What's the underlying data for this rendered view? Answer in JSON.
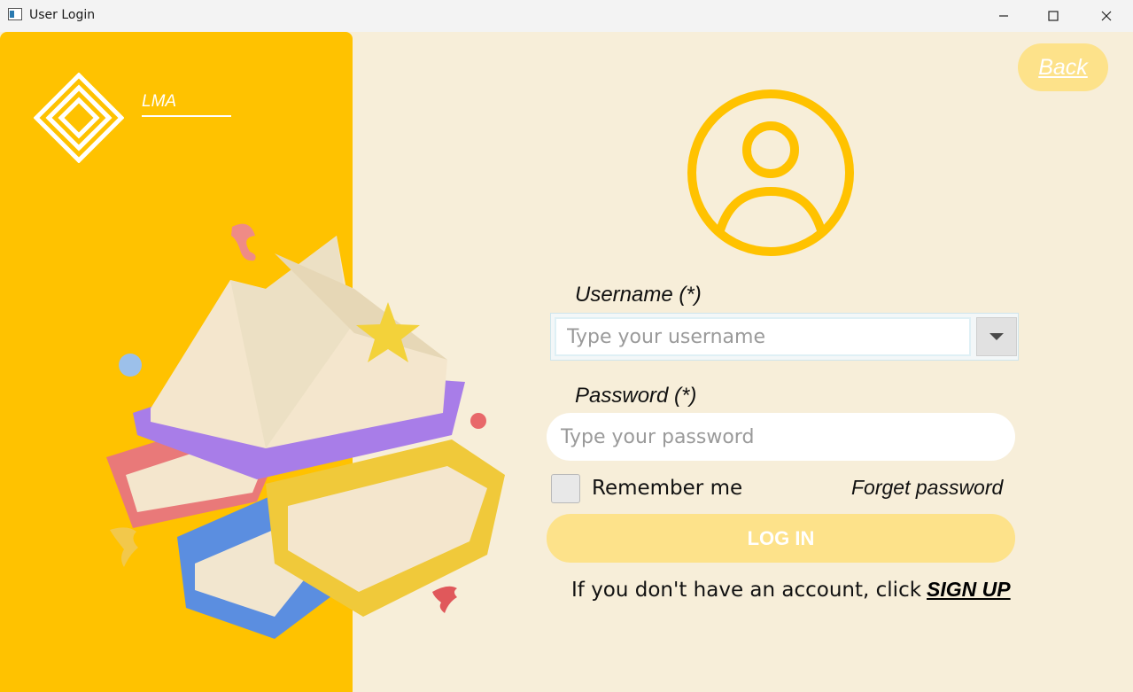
{
  "window": {
    "title": "User Login",
    "controls": [
      "minimize-icon",
      "maximize-icon",
      "close-icon"
    ]
  },
  "brand": {
    "name": "LMA",
    "logo_icon": "maze-diamond-logo"
  },
  "colors": {
    "accent": "#ffc200",
    "background": "#f7eed9",
    "button_light": "#fde28a"
  },
  "header": {
    "back_label": "Back"
  },
  "form": {
    "avatar_icon": "user-circle-icon",
    "username_label": "Username (*)",
    "username_placeholder": "Type your username",
    "password_label": "Password (*)",
    "password_placeholder": "Type your password",
    "remember_label": "Remember me",
    "forget_label": "Forget password",
    "login_label": "LOG IN",
    "signup_prompt": "If you don't have an account, click",
    "signup_label": "SIGN UP"
  }
}
